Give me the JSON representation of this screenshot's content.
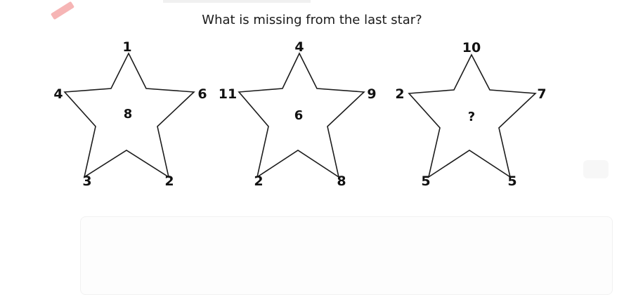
{
  "question": "What is missing from the last star?",
  "stars": [
    {
      "top": "1",
      "right": "6",
      "bottom_right": "2",
      "bottom_left": "3",
      "left": "4",
      "center": "8"
    },
    {
      "top": "4",
      "right": "9",
      "bottom_right": "8",
      "bottom_left": "2",
      "left": "11",
      "center": "6"
    },
    {
      "top": "10",
      "right": "7",
      "bottom_right": "5",
      "bottom_left": "5",
      "left": "2",
      "center": "?"
    }
  ]
}
